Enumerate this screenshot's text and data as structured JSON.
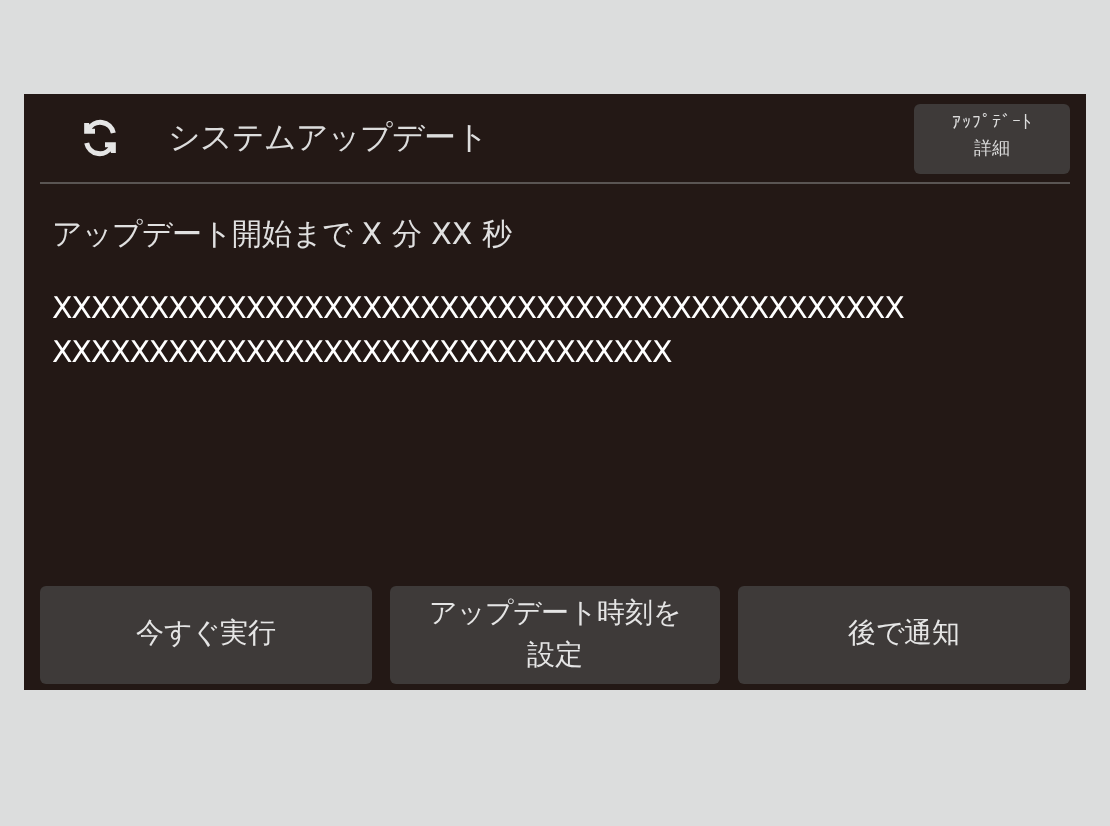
{
  "header": {
    "title": "システムアップデート",
    "detail_button": {
      "lines": [
        "ｱｯﾌﾟﾃﾞｰﾄ",
        "詳細"
      ]
    }
  },
  "countdown": "アップデート開始まで X 分 XX 秒",
  "message_lines": [
    "XXXXXXXXXXXXXXXXXXXXXXXXXXXXXXXXXXXXXXXXXXXX",
    "XXXXXXXXXXXXXXXXXXXXXXXXXXXXXXXX"
  ],
  "buttons": [
    {
      "lines": [
        "今すぐ実行"
      ]
    },
    {
      "lines": [
        "アップデート時刻を",
        "設定"
      ]
    },
    {
      "lines": [
        "後で通知"
      ]
    }
  ]
}
